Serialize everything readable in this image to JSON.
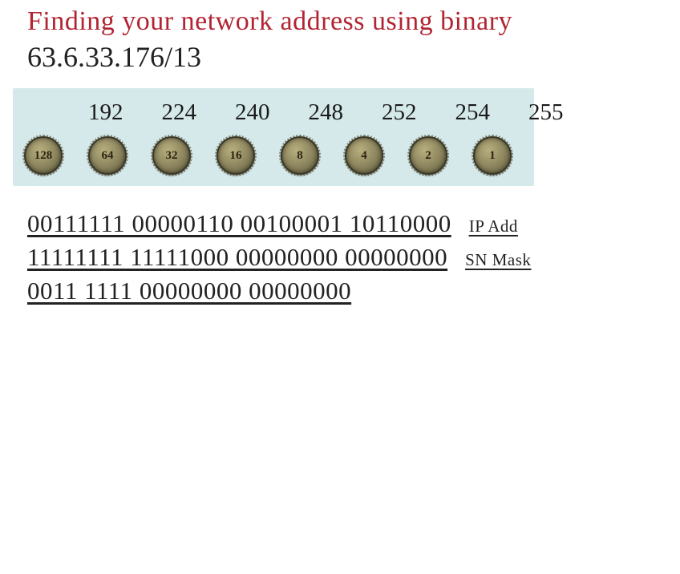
{
  "title": "Finding your network address using binary",
  "subtitle": "63.6.33.176/13",
  "mask_values": [
    "192",
    "224",
    "240",
    "248",
    "252",
    "254",
    "255"
  ],
  "coin_values": [
    "128",
    "64",
    "32",
    "16",
    "8",
    "4",
    "2",
    "1"
  ],
  "binary": {
    "ip": {
      "text": "00111111 00000110 00100001 10110000",
      "label": "IP Add"
    },
    "mask": {
      "text": "11111111 11111000 00000000 00000000",
      "label": "SN Mask"
    },
    "net": {
      "text": "0011 1111 00000000 00000000",
      "label": ""
    }
  }
}
